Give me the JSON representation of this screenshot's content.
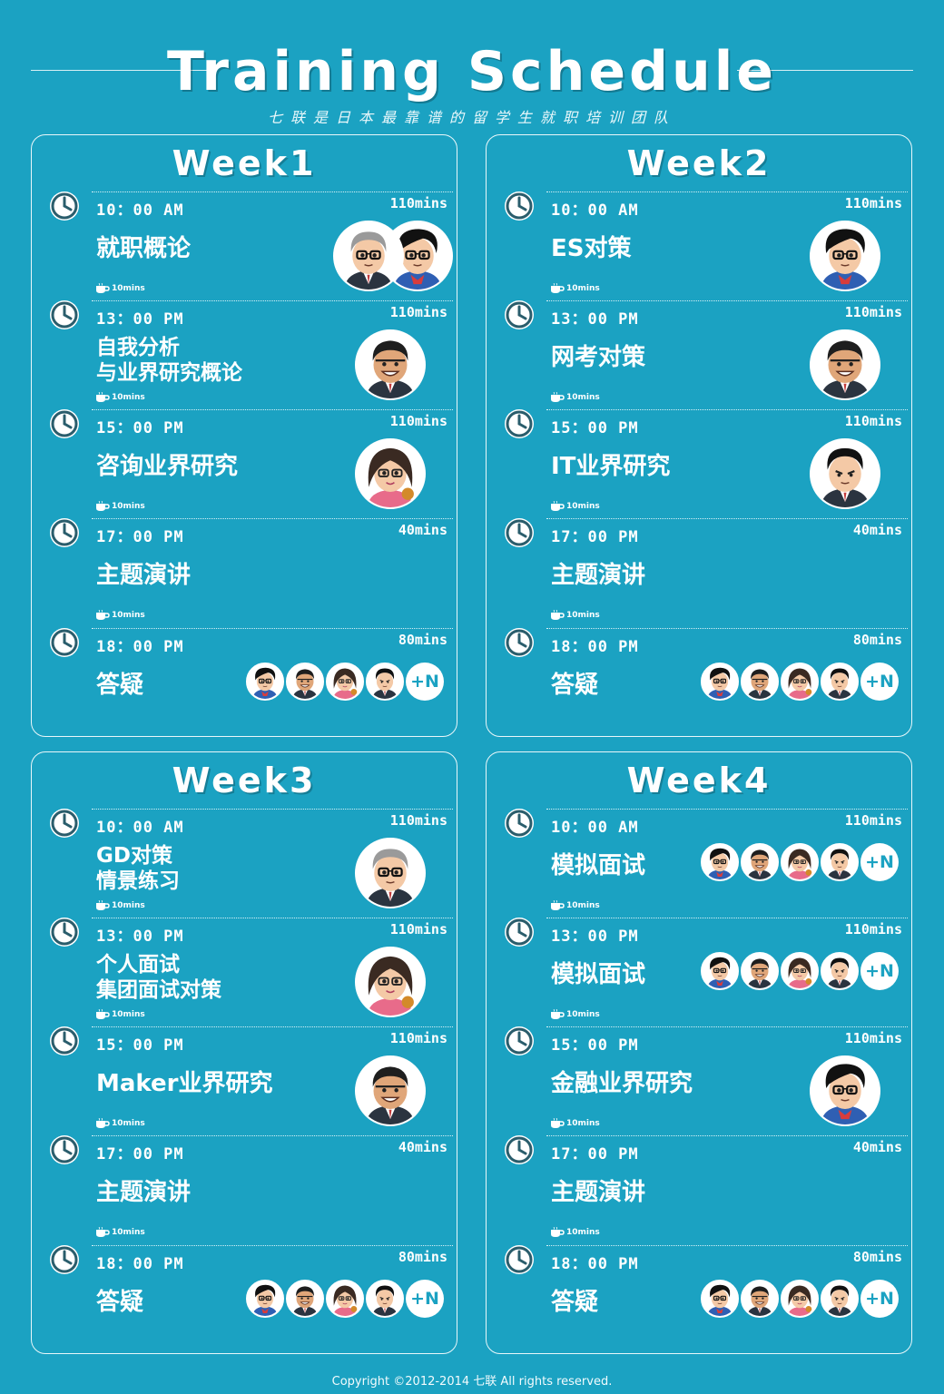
{
  "header": {
    "title": "Training Schedule",
    "subtitle": "七联是日本最靠谱的留学生就职培训团队"
  },
  "break_label": "10mins",
  "plus_label": "+N",
  "colors": {
    "background": "#1ba2c2",
    "text": "#ffffff",
    "panel_border": "#e9f7fa"
  },
  "weeks": [
    {
      "title": "Week1",
      "slots": [
        {
          "time": "10：00 AM",
          "duration": "110mins",
          "topic": "就职概论",
          "avatars": [
            "glasses-man-suit",
            "glasses-man-hero"
          ]
        },
        {
          "time": "13：00 PM",
          "duration": "110mins",
          "topic": "自我分析\n与业界研究概论",
          "avatars": [
            "grin-man"
          ]
        },
        {
          "time": "15：00 PM",
          "duration": "110mins",
          "topic": "咨询业界研究",
          "avatars": [
            "woman-glasses"
          ]
        },
        {
          "time": "17：00 PM",
          "duration": "40mins",
          "topic": "主题演讲",
          "avatars": []
        },
        {
          "time": "18：00 PM",
          "duration": "80mins",
          "topic": "答疑",
          "avatars": [
            "glasses-man-hero",
            "grin-man",
            "woman-glasses",
            "suit-man",
            "+N"
          ]
        }
      ]
    },
    {
      "title": "Week2",
      "slots": [
        {
          "time": "10：00 AM",
          "duration": "110mins",
          "topic": "ES对策",
          "avatars": [
            "glasses-man-hero"
          ]
        },
        {
          "time": "13：00 PM",
          "duration": "110mins",
          "topic": "网考对策",
          "avatars": [
            "grin-man"
          ]
        },
        {
          "time": "15：00 PM",
          "duration": "110mins",
          "topic": "IT业界研究",
          "avatars": [
            "suit-man"
          ]
        },
        {
          "time": "17：00 PM",
          "duration": "40mins",
          "topic": "主题演讲",
          "avatars": []
        },
        {
          "time": "18：00 PM",
          "duration": "80mins",
          "topic": "答疑",
          "avatars": [
            "glasses-man-hero",
            "grin-man",
            "woman-glasses",
            "suit-man",
            "+N"
          ]
        }
      ]
    },
    {
      "title": "Week3",
      "slots": [
        {
          "time": "10：00 AM",
          "duration": "110mins",
          "topic": "GD对策\n情景练习",
          "avatars": [
            "glasses-man-suit"
          ]
        },
        {
          "time": "13：00 PM",
          "duration": "110mins",
          "topic": "个人面试\n集团面试对策",
          "avatars": [
            "woman-glasses"
          ]
        },
        {
          "time": "15：00 PM",
          "duration": "110mins",
          "topic": "Maker业界研究",
          "avatars": [
            "grin-man"
          ]
        },
        {
          "time": "17：00 PM",
          "duration": "40mins",
          "topic": "主题演讲",
          "avatars": []
        },
        {
          "time": "18：00 PM",
          "duration": "80mins",
          "topic": "答疑",
          "avatars": [
            "glasses-man-hero",
            "grin-man",
            "woman-glasses",
            "suit-man",
            "+N"
          ]
        }
      ]
    },
    {
      "title": "Week4",
      "slots": [
        {
          "time": "10：00 AM",
          "duration": "110mins",
          "topic": "模拟面试",
          "avatars": [
            "glasses-man-hero",
            "grin-man",
            "woman-glasses",
            "suit-man",
            "+N"
          ]
        },
        {
          "time": "13：00 PM",
          "duration": "110mins",
          "topic": "模拟面试",
          "avatars": [
            "glasses-man-hero",
            "grin-man",
            "woman-glasses",
            "suit-man",
            "+N"
          ]
        },
        {
          "time": "15：00 PM",
          "duration": "110mins",
          "topic": "金融业界研究",
          "avatars": [
            "glasses-man-hero"
          ]
        },
        {
          "time": "17：00 PM",
          "duration": "40mins",
          "topic": "主题演讲",
          "avatars": []
        },
        {
          "time": "18：00 PM",
          "duration": "80mins",
          "topic": "答疑",
          "avatars": [
            "glasses-man-hero",
            "grin-man",
            "woman-glasses",
            "suit-man",
            "+N"
          ]
        }
      ]
    }
  ],
  "footer": {
    "copyright": "Copyright ©2012-2014 七联 All rights reserved."
  }
}
